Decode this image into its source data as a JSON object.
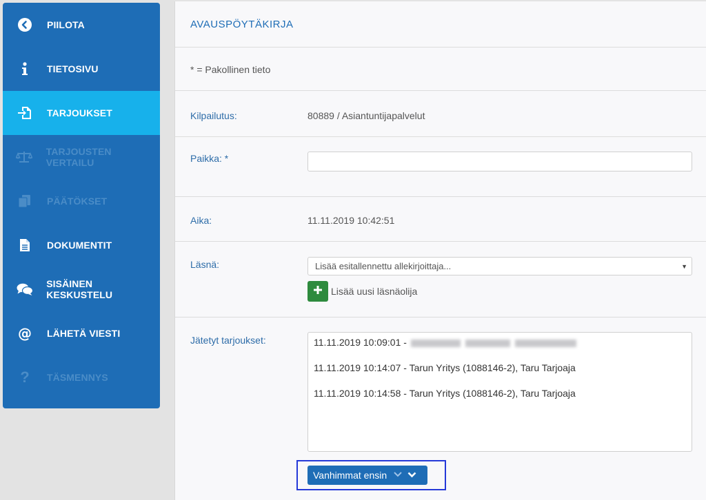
{
  "sidebar": {
    "items": [
      {
        "label": "PIILOTA",
        "icon": "chevron-left-circle-icon",
        "state": "normal"
      },
      {
        "label": "TIETOSIVU",
        "icon": "info-icon",
        "state": "normal"
      },
      {
        "label": "TARJOUKSET",
        "icon": "file-import-icon",
        "state": "active"
      },
      {
        "label": "TARJOUSTEN VERTAILU",
        "icon": "balance-scale-icon",
        "state": "disabled"
      },
      {
        "label": "PÄÄTÖKSET",
        "icon": "decision-icon",
        "state": "disabled"
      },
      {
        "label": "DOKUMENTIT",
        "icon": "document-icon",
        "state": "normal"
      },
      {
        "label": "SISÄINEN KESKUSTELU",
        "icon": "comments-icon",
        "state": "normal"
      },
      {
        "label": "LÄHETÄ VIESTI",
        "icon": "at-sign-icon",
        "state": "normal"
      },
      {
        "label": "TÄSMENNYS",
        "icon": "question-icon",
        "state": "disabled"
      }
    ]
  },
  "page": {
    "title": "AVAUSPÖYTÄKIRJA",
    "required_note": "* = Pakollinen tieto"
  },
  "form": {
    "kilpailutus_label": "Kilpailutus:",
    "kilpailutus_value": "80889 / Asiantuntijapalvelut",
    "paikka_label": "Paikka: *",
    "paikka_value": "",
    "aika_label": "Aika:",
    "aika_value": "11.11.2019 10:42:51",
    "lasna_label": "Läsnä:",
    "lasna_select_placeholder": "Lisää esitallennettu allekirjoittaja...",
    "add_attendee_label": "Lisää uusi läsnäolija",
    "offers_label": "Jätetyt tarjoukset:",
    "offers": [
      {
        "text": "11.11.2019 10:09:01 - "
      },
      {
        "text": "11.11.2019 10:14:07 - Tarun Yritys (1088146-2), Taru Tarjoaja"
      },
      {
        "text": "11.11.2019 10:14:58 - Tarun Yritys (1088146-2), Taru Tarjoaja"
      }
    ],
    "sort_label": "Vanhimmat ensin"
  },
  "colors": {
    "sidebar_bg": "#1e6db6",
    "sidebar_active": "#17b1eb",
    "add_button": "#2e8b3e",
    "accent_text": "#2d6ca8"
  }
}
